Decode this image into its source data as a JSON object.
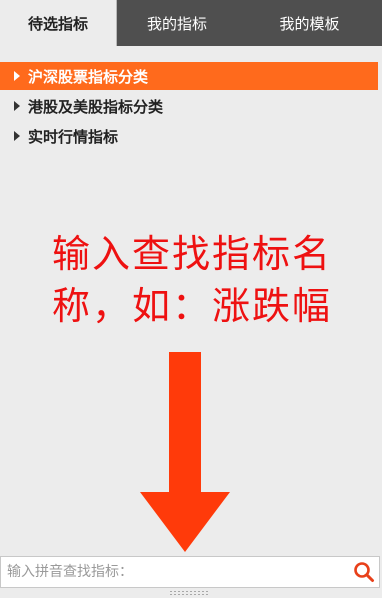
{
  "tabs": [
    {
      "label": "待选指标",
      "active": true
    },
    {
      "label": "我的指标",
      "active": false
    },
    {
      "label": "我的模板",
      "active": false
    }
  ],
  "categories": [
    {
      "label": "沪深股票指标分类",
      "active": true
    },
    {
      "label": "港股及美股指标分类",
      "active": false
    },
    {
      "label": "实时行情指标",
      "active": false
    }
  ],
  "hint": {
    "line1": "输入查找指标名",
    "line2": "称，如：涨跌幅"
  },
  "search": {
    "placeholder": "输入拼音查找指标：",
    "value": ""
  },
  "colors": {
    "accent": "#ff6a1c",
    "tabbar": "#4f4f4f",
    "hint": "#ee1111",
    "arrow": "#ff3a0a",
    "search_icon": "#e8401a"
  },
  "icons": {
    "category_expand": "triangle-right-icon",
    "search": "search-icon",
    "arrow": "arrow-down-icon",
    "resize": "resize-grip-icon"
  }
}
